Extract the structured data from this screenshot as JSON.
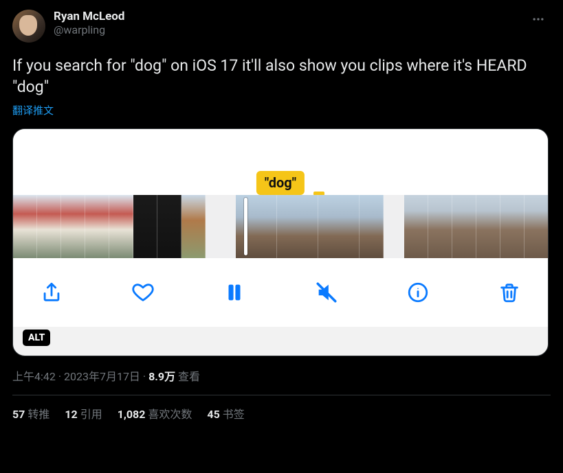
{
  "user": {
    "display_name": "Ryan McLeod",
    "handle": "@warpling"
  },
  "body_text": "If you search for \"dog\" on iOS 17 it'll also show you clips where it's HEARD \"dog\"",
  "translate_label": "翻译推文",
  "media": {
    "badge_text": "\"dog\"",
    "alt_label": "ALT"
  },
  "meta": {
    "time": "上午4:42",
    "separator": " · ",
    "date": "2023年7月17日",
    "views_count": "8.9万",
    "views_label": " 查看"
  },
  "stats": {
    "retweets_count": "57",
    "retweets_label": "转推",
    "quotes_count": "12",
    "quotes_label": "引用",
    "likes_count": "1,082",
    "likes_label": "喜欢次数",
    "bookmarks_count": "45",
    "bookmarks_label": "书签"
  }
}
